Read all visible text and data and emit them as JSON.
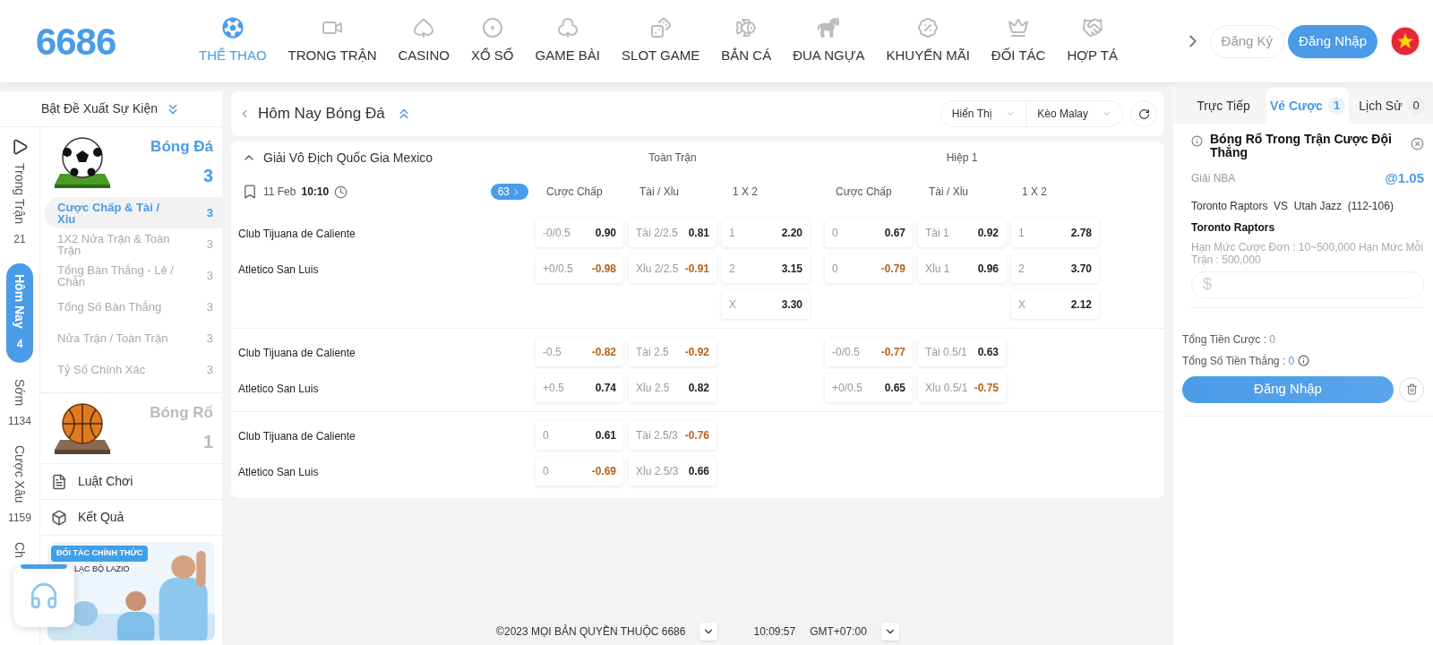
{
  "header": {
    "logo": "6686",
    "nav": [
      {
        "label": "THỂ THAO",
        "selected": true
      },
      {
        "label": "TRONG TRẬN",
        "selected": false
      },
      {
        "label": "CASINO",
        "selected": false
      },
      {
        "label": "XỔ SỐ",
        "selected": false
      },
      {
        "label": "GAME BÀI",
        "selected": false
      },
      {
        "label": "SLOT GAME",
        "selected": false
      },
      {
        "label": "BẮN CÁ",
        "selected": false
      },
      {
        "label": "ĐUA NGỰA",
        "selected": false
      },
      {
        "label": "KHUYẾN MÃI",
        "selected": false
      },
      {
        "label": "ĐỐI TÁC",
        "selected": false
      },
      {
        "label": "HỢP TÁ",
        "selected": false
      }
    ],
    "register": "Đăng Ký",
    "login": "Đăng Nhập"
  },
  "sidebar": {
    "suggest_toggle": "Bật Đề Xuất Sự Kiện",
    "periods": [
      {
        "label": "Trong Trận",
        "count": "21",
        "selected": false
      },
      {
        "label": "Hôm Nay",
        "count": "4",
        "selected": true
      },
      {
        "label": "Sớm",
        "count": "1134",
        "selected": false
      },
      {
        "label": "Cược Xâu",
        "count": "1159",
        "selected": false
      },
      {
        "label": "Ch",
        "selected": false
      }
    ],
    "sports": [
      {
        "kind": "soccer",
        "name": "Bóng Đá",
        "count": "3",
        "selected": true,
        "markets": [
          {
            "label": "Cược Chấp & Tài / Xỉu",
            "count": "3",
            "selected": true
          },
          {
            "label": "1X2 Nửa Trận & Toàn Trận",
            "count": "3",
            "selected": false
          },
          {
            "label": "Tổng Bàn Thắng - Lẻ / Chẵn",
            "count": "3",
            "selected": false
          },
          {
            "label": "Tổng Số Bàn Thắng",
            "count": "3",
            "selected": false
          },
          {
            "label": "Nửa Trận / Toàn Trận",
            "count": "3",
            "selected": false
          },
          {
            "label": "Tỷ Số Chính Xác",
            "count": "3",
            "selected": false
          }
        ]
      },
      {
        "kind": "basketball",
        "name": "Bóng Rổ",
        "count": "1",
        "selected": false
      }
    ],
    "links": [
      "Luật Chơi",
      "Kết Quả"
    ],
    "banner": {
      "badge": "ĐỐI TÁC CHÍNH THỨC",
      "subtitle": "LẠC BỘ LAZIO"
    }
  },
  "main": {
    "title": "Hôm Nay Bóng Đá",
    "display_select": "Hiển Thị",
    "odds_select": "Kèo Malay",
    "league": {
      "name": "Giải Vô Địch Quốc Gia Mexico",
      "expanded": true,
      "sections": [
        "Toàn Trận",
        "Hiệp 1"
      ],
      "date": "11 Feb",
      "time": "10:10",
      "more_count": "63",
      "column_headers": [
        "Cược Chấp",
        "Tài / Xỉu",
        "1 X 2",
        "Cược Chấp",
        "Tài / Xỉu",
        "1 X 2"
      ],
      "groups": [
        {
          "rows": [
            {
              "team": "Club Tijuana de Caliente",
              "cells": [
                {
                  "label": "-0/0.5",
                  "value": "0.90",
                  "negative": false
                },
                {
                  "label": "Tài 2/2.5",
                  "value": "0.81",
                  "negative": false
                },
                {
                  "label": "1",
                  "value": "2.20",
                  "negative": false
                },
                {
                  "label": "0",
                  "value": "0.67",
                  "negative": false
                },
                {
                  "label": "Tài 1",
                  "value": "0.92",
                  "negative": false
                },
                {
                  "label": "1",
                  "value": "2.78",
                  "negative": false
                }
              ]
            },
            {
              "team": "Atletico San Luis",
              "cells": [
                {
                  "label": "+0/0.5",
                  "value": "-0.98",
                  "negative": true
                },
                {
                  "label": "Xỉu 2/2.5",
                  "value": "-0.91",
                  "negative": true
                },
                {
                  "label": "2",
                  "value": "3.15",
                  "negative": false
                },
                {
                  "label": "0",
                  "value": "-0.79",
                  "negative": true
                },
                {
                  "label": "Xỉu 1",
                  "value": "0.96",
                  "negative": false
                },
                {
                  "label": "2",
                  "value": "3.70",
                  "negative": false
                }
              ]
            },
            {
              "cells": [
                null,
                null,
                {
                  "label": "X",
                  "value": "3.30",
                  "negative": false
                },
                null,
                null,
                {
                  "label": "X",
                  "value": "2.12",
                  "negative": false
                }
              ]
            }
          ]
        },
        {
          "rows": [
            {
              "team": "Club Tijuana de Caliente",
              "cells": [
                {
                  "label": "-0.5",
                  "value": "-0.82",
                  "negative": true
                },
                {
                  "label": "Tài 2.5",
                  "value": "-0.92",
                  "negative": true
                },
                null,
                {
                  "label": "-0/0.5",
                  "value": "-0.77",
                  "negative": true
                },
                {
                  "label": "Tài 0.5/1",
                  "value": "0.63",
                  "negative": false
                },
                null
              ]
            },
            {
              "team": "Atletico San Luis",
              "cells": [
                {
                  "label": "+0.5",
                  "value": "0.74",
                  "negative": false
                },
                {
                  "label": "Xỉu 2.5",
                  "value": "0.82",
                  "negative": false
                },
                null,
                {
                  "label": "+0/0.5",
                  "value": "0.65",
                  "negative": false
                },
                {
                  "label": "Xỉu 0.5/1",
                  "value": "-0.75",
                  "negative": true
                },
                null
              ]
            }
          ]
        },
        {
          "rows": [
            {
              "team": "Club Tijuana de Caliente",
              "cells": [
                {
                  "label": "0",
                  "value": "0.61",
                  "negative": false
                },
                {
                  "label": "Tài 2.5/3",
                  "value": "-0.76",
                  "negative": true
                },
                null,
                null,
                null,
                null
              ]
            },
            {
              "team": "Atletico San Luis",
              "cells": [
                {
                  "label": "0",
                  "value": "-0.69",
                  "negative": true
                },
                {
                  "label": "Xỉu 2.5/3",
                  "value": "0.66",
                  "negative": false
                },
                null,
                null,
                null,
                null
              ]
            }
          ]
        }
      ]
    }
  },
  "footer": {
    "copyright": "©2023 MỌI BẢN QUYỀN THUỘC 6686",
    "clock": "10:09:57",
    "timezone": "GMT+07:00"
  },
  "bet_slip": {
    "tabs": [
      {
        "label": "Trực Tiếp",
        "selected": false
      },
      {
        "label": "Vé Cược",
        "count": "1",
        "selected": true
      },
      {
        "label": "Lịch Sử",
        "count": "0",
        "selected": false
      }
    ],
    "title": "Bóng Rổ Trong Trận Cược Đội Thắng",
    "league": "Giải NBA",
    "odds": "@1.05",
    "match": "Toronto Raptors  VS  Utah Jazz  (112-106)",
    "pick": "Toronto Raptors",
    "limits": "Hạn Mức Cược Đơn : 10~500,000 Hạn Mức Mỗi Trận : 500,000",
    "stake_placeholder": "$",
    "total_stake_label": "Tổng Tiền Cược : ",
    "total_stake": "0",
    "total_win_label": "Tổng Số Tiền Thắng : ",
    "total_win": "0",
    "login": "Đăng Nhập"
  }
}
